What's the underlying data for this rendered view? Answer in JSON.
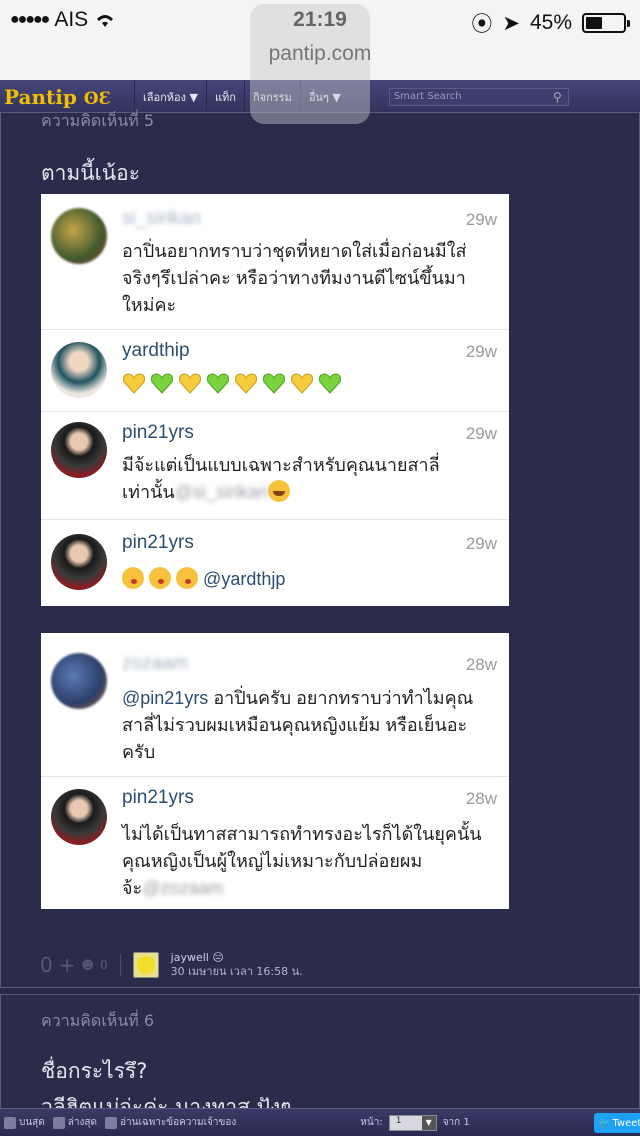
{
  "statusbar": {
    "carrier": "AIS",
    "time": "21:19",
    "battery": "45%",
    "battery_level": 0.45,
    "url": "pantip.com"
  },
  "nav": {
    "logo": "Pantip",
    "items": [
      "เลือกห้อง ▼",
      "แท็ก",
      "กิจกรรม",
      "อื่นๆ ▼"
    ],
    "search_placeholder": "Smart Search"
  },
  "comment5": {
    "label": "ความคิดเห็นที่ 5",
    "text": "ตามนี้เน้อะ",
    "card1": [
      {
        "user": "si_sirikan",
        "time": "29w",
        "text": "อาปิ่นอยากทราบว่าชุดที่หยาดใส่เมื่อก่อนมีใส่จริงๆรึเปล่าคะ หรือว่าทางทีมงานดีไซน์ขึ้นมาใหม่คะ"
      },
      {
        "user": "yardthip",
        "time": "29w",
        "text": ""
      },
      {
        "user": "pin21yrs",
        "time": "29w",
        "text": "มีจ้ะแต่เป็นแบบเฉพาะสำหรับคุณนายสาลี่เท่านั้น",
        "mention": "@si_sirikan"
      },
      {
        "user": "pin21yrs",
        "time": "29w",
        "text": "",
        "mention": "@yardthjp"
      }
    ],
    "card2": [
      {
        "user": "zozaam",
        "time": "28w",
        "mention": "@pin21yrs",
        "text": " อาปิ่นครับ อยากทราบว่าทำไมคุณสาลี่ไม่รวบผมเหมือนคุณหญิงแย้ม หรือเย็นอะครับ"
      },
      {
        "user": "pin21yrs",
        "time": "28w",
        "text": "ไม่ได้เป็นทาสสามารถทำทรงอะไรก็ได้ในยุคนั้น คุณหญิงเป็นผู้ใหญ่ไม่เหมาะกับปล่อยผมจ้ะ",
        "mention": "@zozaam"
      }
    ],
    "footer": {
      "score": "0",
      "plus": "+",
      "count": "0",
      "poster": "jaywell",
      "timestamp": "30 เมษายน เวลา 16:58 น."
    }
  },
  "comment6": {
    "label": "ความคิดเห็นที่ 6",
    "text": "ชื่อกระไรรึ?",
    "text2": "วลีฮิตแม่จ่ะค่ะ นางทาส ปังๆ"
  },
  "bottombar": {
    "top": "บนสุด",
    "bottom": "ล่างสุด",
    "owner_only": "อ่านเฉพาะข้อความเจ้าของ",
    "page_label": "หน้า:",
    "page_value": "1",
    "of_label": "จาก 1",
    "tweet": "Tweet"
  }
}
